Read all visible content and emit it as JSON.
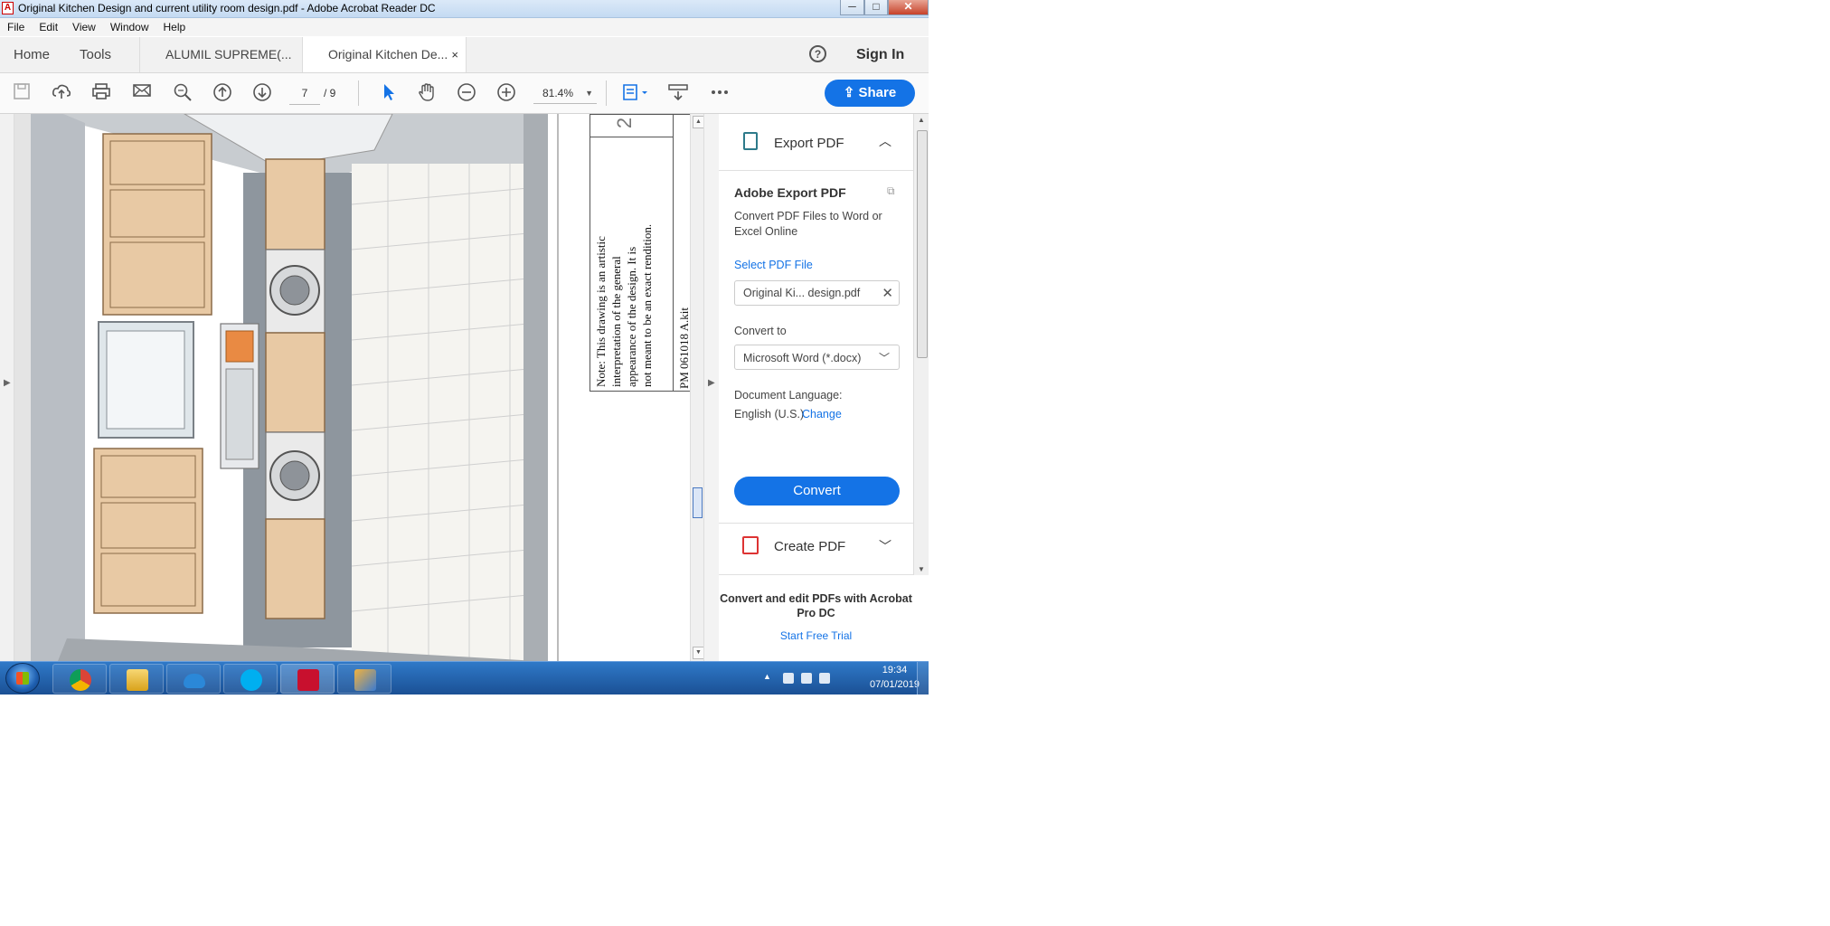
{
  "window": {
    "title": "Original Kitchen Design and current utility room design.pdf - Adobe Acrobat Reader DC",
    "minimize": "─",
    "maximize": "□",
    "close": "✕"
  },
  "menu": [
    "File",
    "Edit",
    "View",
    "Window",
    "Help"
  ],
  "tabs": {
    "home": "Home",
    "tools": "Tools",
    "doc1": "ALUMIL SUPREME(...",
    "doc2": "Original Kitchen De...",
    "doc2_close": "×"
  },
  "header": {
    "help_glyph": "?",
    "sign_in": "Sign In"
  },
  "toolbar": {
    "page_current": "7",
    "page_total": "/ 9",
    "zoom": "81.4%",
    "share": "Share",
    "icons": [
      "save-icon",
      "upload-icon",
      "print-icon",
      "email-icon",
      "zoom-search-icon",
      "page-up-icon",
      "page-down-icon",
      "select-cursor-icon",
      "hand-tool-icon",
      "zoom-out-icon",
      "zoom-in-icon",
      "fit-page-icon",
      "scroll-mode-icon",
      "more-icon"
    ]
  },
  "document": {
    "note_lines": [
      "Note: This drawing is an artistic",
      "interpretation of the general",
      "appearance of the design. It is",
      "not meant to be an exact rendition."
    ],
    "code": "PM 061018 A.kit",
    "top_glyph": "2"
  },
  "export_pane": {
    "section_title": "Export PDF",
    "heading": "Adobe Export PDF",
    "description": "Convert PDF Files to Word or Excel Online",
    "select_label": "Select PDF File",
    "file_name": "Original Ki... design.pdf",
    "file_clear": "✕",
    "convert_to_label": "Convert to",
    "format_value": "Microsoft Word (*.docx)",
    "language_label": "Document Language:",
    "language_value": "English (U.S.)",
    "change_link": "Change",
    "convert_button": "Convert",
    "create_title": "Create PDF",
    "promo": "Convert and edit PDFs with Acrobat Pro DC",
    "trial_link": "Start Free Trial"
  },
  "taskbar": {
    "apps": [
      "chrome",
      "file-explorer",
      "onedrive",
      "skype",
      "acrobat-reader",
      "paint"
    ],
    "time": "19:34",
    "date": "07/01/2019"
  },
  "colors": {
    "accent": "#1473e6",
    "taskbar": "#1a4f93",
    "close_button": "#c7422a"
  }
}
